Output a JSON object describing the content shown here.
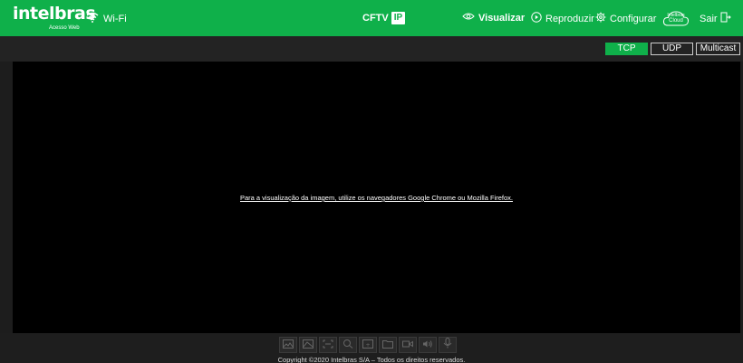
{
  "colors": {
    "brand_green": "#0fb04a",
    "video_bg": "#000000",
    "chrome_dark": "#1a1a1a"
  },
  "header": {
    "logo_text": "intelbras",
    "logo_subtext": "Acesso Web",
    "wifi_label": "Wi-Fi",
    "product_label": "CFTV",
    "product_badge": "IP",
    "nav": [
      {
        "label": "Visualizar",
        "icon": "eye-icon",
        "active": true
      },
      {
        "label": "Reproduzir",
        "icon": "play-circle-icon",
        "active": false
      },
      {
        "label": "Configurar",
        "icon": "gear-icon",
        "active": false
      }
    ],
    "cloud_label_line1": "Intelbras",
    "cloud_label_line2": "Cloud",
    "logout_label": "Sair"
  },
  "stream": {
    "options": [
      {
        "label": "TCP",
        "active": true
      },
      {
        "label": "UDP",
        "active": false
      },
      {
        "label": "Multicast",
        "active": false
      }
    ]
  },
  "video": {
    "notice": "Para a visualização da imagem, utilize os navegadores Google Chrome ou Mozilla Firefox."
  },
  "toolbar": {
    "icons": [
      "snapshot-icon",
      "image-icon",
      "fullscreen-icon",
      "zoom-icon",
      "record-icon",
      "folder-icon",
      "video-icon",
      "audio-icon",
      "microphone-icon"
    ]
  },
  "footer": {
    "copyright": "Copyright ©2020 Intelbras S/A – Todos os direitos reservados."
  }
}
